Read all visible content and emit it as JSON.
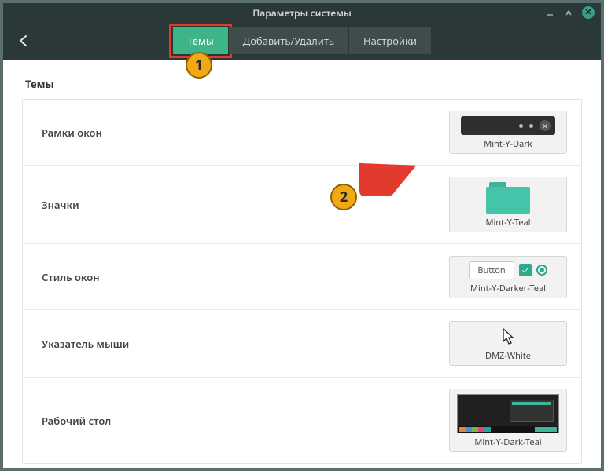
{
  "window": {
    "title": "Параметры системы"
  },
  "tabs": {
    "themes": "Темы",
    "addremove": "Добавить/Удалить",
    "settings": "Настройки",
    "active_index": 0
  },
  "section_title": "Темы",
  "rows": {
    "window_borders": {
      "label": "Рамки окон",
      "value": "Mint-Y-Dark"
    },
    "icons": {
      "label": "Значки",
      "value": "Mint-Y-Teal"
    },
    "controls": {
      "label": "Стиль окон",
      "value": "Mint-Y-Darker-Teal",
      "button_sample": "Button"
    },
    "mouse_pointer": {
      "label": "Указатель мыши",
      "value": "DMZ-White"
    },
    "desktop": {
      "label": "Рабочий стол",
      "value": "Mint-Y-Dark-Teal"
    }
  },
  "annotations": {
    "badge1": "1",
    "badge2": "2"
  },
  "colors": {
    "accent": "#3eb489",
    "header": "#2b3838",
    "highlight": "#e23b2e",
    "badge": "#f2a814"
  }
}
